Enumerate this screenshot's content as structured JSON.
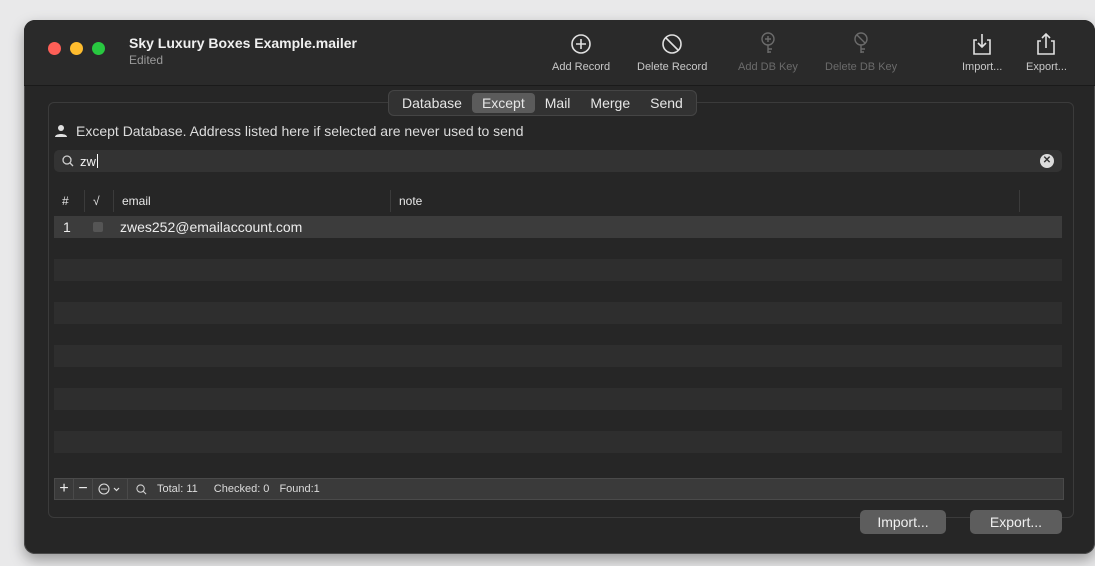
{
  "window": {
    "title": "Sky Luxury Boxes Example.mailer",
    "subtitle": "Edited"
  },
  "toolbar": {
    "add_record": "Add Record",
    "delete_record": "Delete Record",
    "add_db_key": "Add DB Key",
    "delete_db_key": "Delete DB Key",
    "import": "Import...",
    "export": "Export..."
  },
  "tabs": [
    "Database",
    "Except",
    "Mail",
    "Merge",
    "Send"
  ],
  "active_tab": "Except",
  "info_text": "Except Database. Address listed here if selected are never used to send",
  "search": {
    "value": "zw"
  },
  "table": {
    "headers": {
      "num": "#",
      "check": "√",
      "email": "email",
      "note": "note"
    },
    "rows": [
      {
        "num": "1",
        "checked": false,
        "email": "zwes252@emailaccount.com",
        "note": ""
      }
    ]
  },
  "status": {
    "total": "Total: 11",
    "checked": "Checked: 0",
    "found": "Found:1"
  },
  "bottom_buttons": {
    "import": "Import...",
    "export": "Export..."
  },
  "colors": {
    "window_bg": "#262626",
    "close": "#fe5f57",
    "minimize": "#febc2e",
    "zoom": "#28c840"
  }
}
